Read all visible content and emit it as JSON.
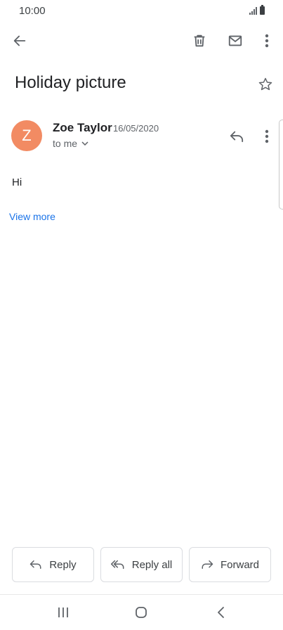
{
  "status_bar": {
    "time": "10:00",
    "icons": [
      "signal-icon",
      "battery-icon"
    ]
  },
  "toolbar": {
    "icons": [
      "back-arrow-icon",
      "trash-icon",
      "mail-icon",
      "more-vert-icon"
    ]
  },
  "email": {
    "subject": "Holiday picture",
    "sender": {
      "initial": "Z",
      "name": "Zoe Taylor",
      "date": "16/05/2020",
      "avatar_color": "#f28b63"
    },
    "recipients_label": "to me",
    "body": "Hi",
    "view_more": "View more"
  },
  "actions": {
    "reply": "Reply",
    "reply_all": "Reply all",
    "forward": "Forward"
  },
  "colors": {
    "accent": "#1a73e8",
    "icon": "#5f6368"
  },
  "nav_bar": {
    "icons": [
      "recents-icon",
      "home-icon",
      "back-icon"
    ]
  }
}
